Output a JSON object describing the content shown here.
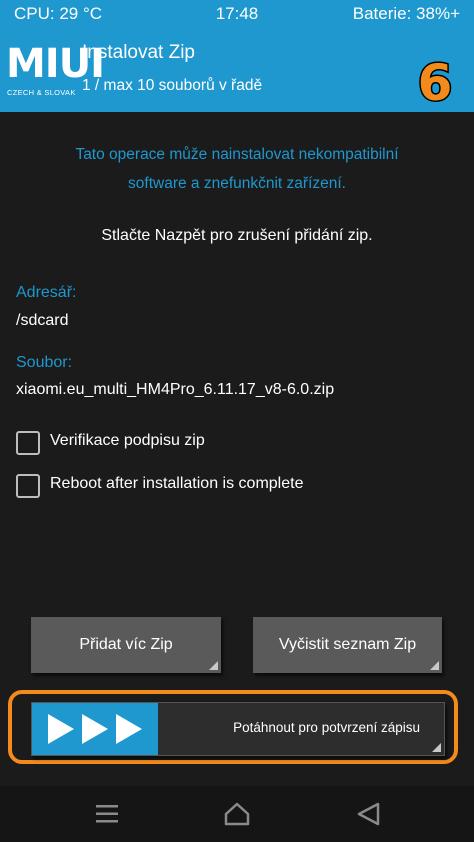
{
  "status_bar": {
    "cpu": "CPU: 29 °C",
    "time": "17:48",
    "battery": "Baterie: 38%+"
  },
  "header": {
    "logo_text": "MIUI",
    "logo_subtext": "CZECH & SLOVAK",
    "title": "Instalovat Zip",
    "subtitle": "1 / max 10 souborů v řadě",
    "badge": "6"
  },
  "warning": {
    "line1": "Tato operace může nainstalovat nekompatibilní",
    "line2": "software a znefunkčnit zařízení."
  },
  "back_hint": "Stlačte Nazpět pro zrušení přidání zip.",
  "directory": {
    "label": "Adresář:",
    "value": "/sdcard"
  },
  "file": {
    "label": "Soubor:",
    "value": "xiaomi.eu_multi_HM4Pro_6.11.17_v8-6.0.zip"
  },
  "options": [
    {
      "label": "Verifikace podpisu zip",
      "checked": false
    },
    {
      "label": "Reboot after installation is complete",
      "checked": false
    }
  ],
  "buttons": {
    "add_zip": "Přidat víc Zip",
    "clear_list": "Vyčistit seznam Zip"
  },
  "swipe": {
    "label": "Potáhnout pro potvrzení zápisu"
  },
  "colors": {
    "accent": "#1e98cf",
    "highlight": "#f28a1c",
    "background": "#1b1b1b",
    "button": "#5a5a5a"
  },
  "icons": {
    "nav_menu": "menu-icon",
    "nav_home": "home-icon",
    "nav_back": "back-icon",
    "swipe": "triple-arrow-icon"
  }
}
